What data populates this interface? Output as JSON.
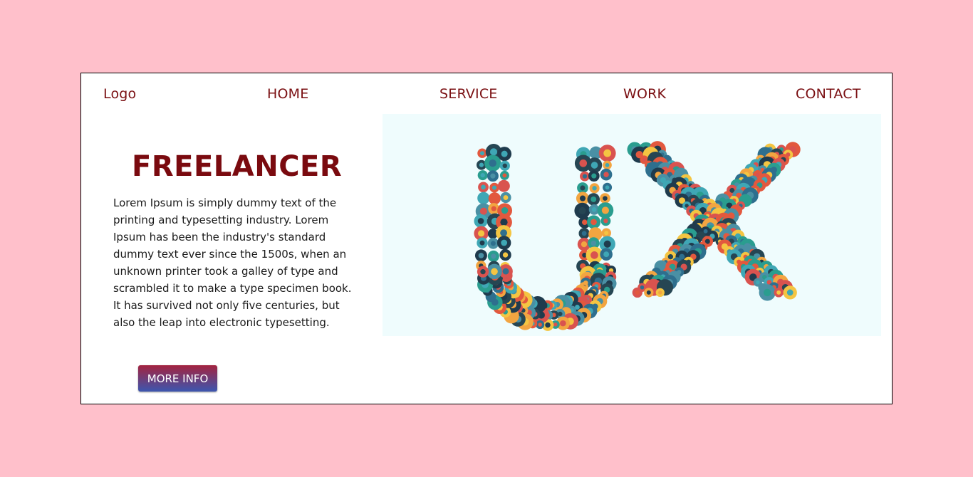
{
  "nav": {
    "logo": "Logo",
    "items": [
      "HOME",
      "SERVICE",
      "WORK",
      "CONTACT"
    ]
  },
  "hero": {
    "title": "FREELANCER",
    "description": "Lorem Ipsum is simply dummy text of the printing and typesetting industry. Lorem Ipsum has been the industry's standard dummy text ever since the 1500s, when an unknown printer took a galley of type and scrambled it to make a type specimen book. It has survived not only five centuries, but also the leap into electronic typesetting.",
    "button_label": "MORE INFO",
    "image_icon": "ux-icon-collage"
  },
  "colors": {
    "background": "#ffc0cb",
    "nav_text": "#7a0f12",
    "title": "#7a0a0f",
    "button_top": "#a3233f",
    "button_bottom": "#3c56b0",
    "image_bg": "#effcfd"
  }
}
